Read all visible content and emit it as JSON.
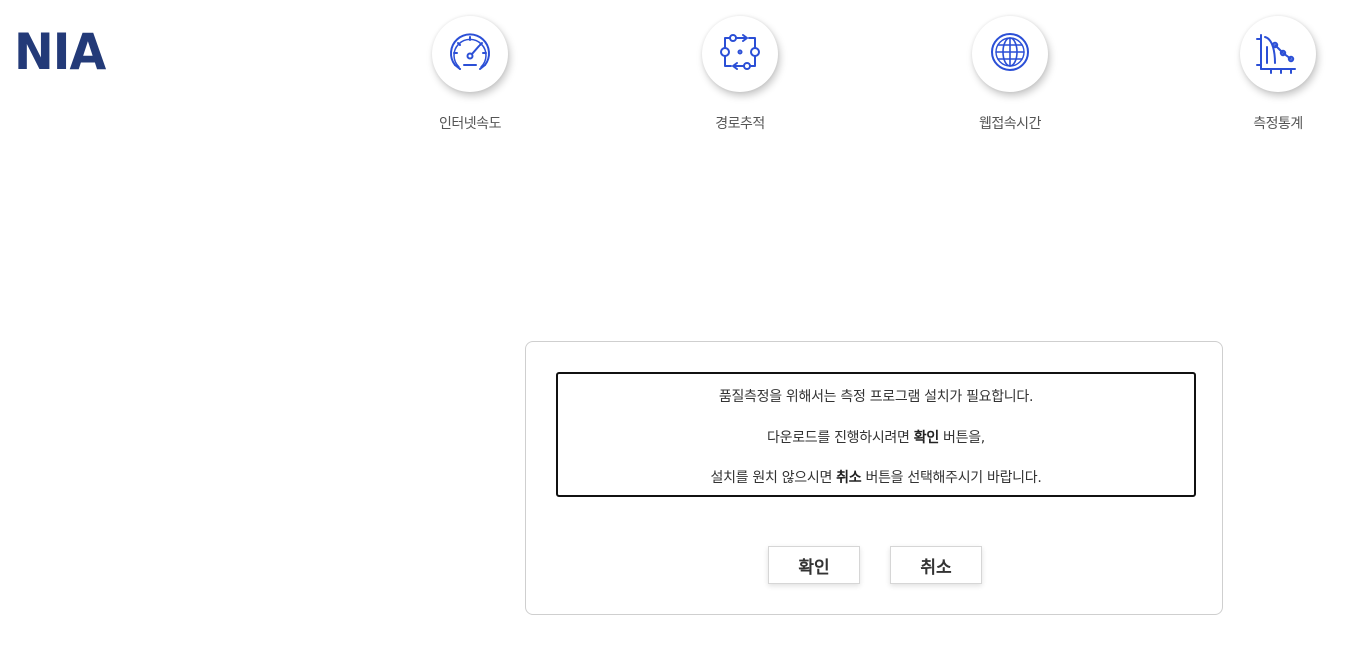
{
  "header": {
    "logo_text": "NIA",
    "brand_color": "#233a78",
    "nav": [
      {
        "label": "인터넷속도",
        "icon": "speedometer-icon"
      },
      {
        "label": "경로추적",
        "icon": "route-trace-icon"
      },
      {
        "label": "웹접속시간",
        "icon": "globe-icon"
      },
      {
        "label": "측정통계",
        "icon": "statistics-chart-icon"
      }
    ],
    "icon_color": "#2b4fd6"
  },
  "dialog": {
    "line1": "품질측정을 위해서는 측정 프로그램 설치가 필요합니다.",
    "line2_pre": "다운로드를 진행하시려면 ",
    "line2_bold": "확인",
    "line2_post": " 버튼을,",
    "line3_pre": "설치를 원치 않으시면 ",
    "line3_bold": "취소",
    "line3_post": " 버튼을 선택해주시기 바랍니다.",
    "confirm_label": "확인",
    "cancel_label": "취소"
  }
}
